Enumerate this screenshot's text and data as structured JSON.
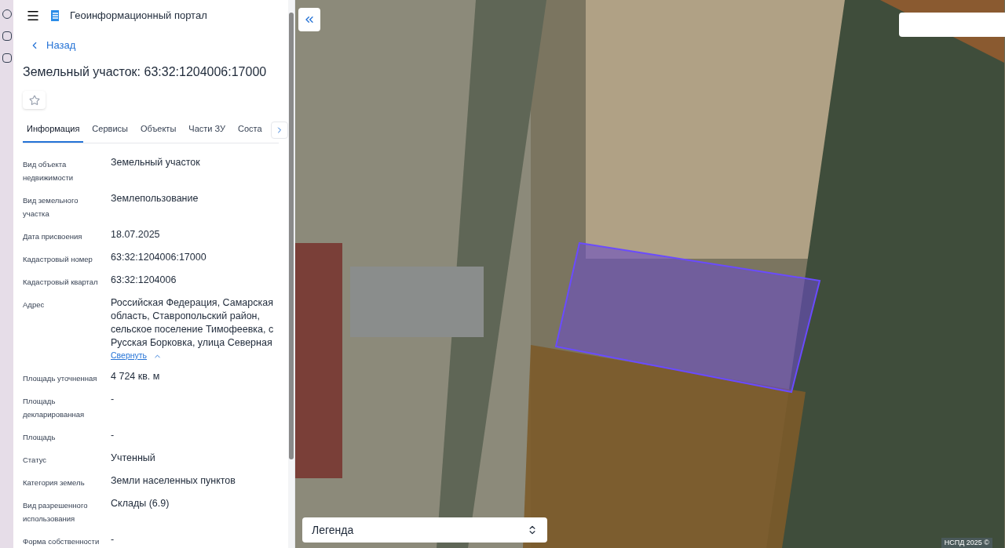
{
  "header": {
    "title": "Геоинформационный портал"
  },
  "back_link": "Назад",
  "object_title": "Земельный участок: 63:32:1204006:17000",
  "favorite": {
    "on": false
  },
  "tabs": [
    {
      "label": "Информация",
      "selected": true
    },
    {
      "label": "Сервисы",
      "selected": false
    },
    {
      "label": "Объекты",
      "selected": false
    },
    {
      "label": "Части ЗУ",
      "selected": false
    },
    {
      "label": "Соста",
      "selected": false
    }
  ],
  "properties": [
    {
      "label": "Вид объекта недвижимости",
      "value": "Земельный участок"
    },
    {
      "label": "Вид земельного участка",
      "value": "Землепользование"
    },
    {
      "label": "Дата присвоения",
      "value": "18.07.2025"
    },
    {
      "label": "Кадастровый номер",
      "value": "63:32:1204006:17000"
    },
    {
      "label": "Кадастровый квартал",
      "value": "63:32:1204006"
    },
    {
      "label": "Адрес",
      "value": "Российская Федерация, Самарская область, Ставропольский район, сельское поселение Тимофеевка, с Русская Борковка, улица Северная",
      "toggle": "Свернуть"
    },
    {
      "label": "Площадь уточненная",
      "value": "4 724 кв. м"
    },
    {
      "label": "Площадь декларированная",
      "value": "-"
    },
    {
      "label": "Площадь",
      "value": "-"
    },
    {
      "label": "Статус",
      "value": "Учтенный"
    },
    {
      "label": "Категория земель",
      "value": "Земли населенных пунктов"
    },
    {
      "label": "Вид разрешенного использования",
      "value": "Склады (6.9)"
    },
    {
      "label": "Форма собственности",
      "value": "-"
    }
  ],
  "map": {
    "legend": "Легенда",
    "attribution": "НСПД 2025 ©"
  }
}
